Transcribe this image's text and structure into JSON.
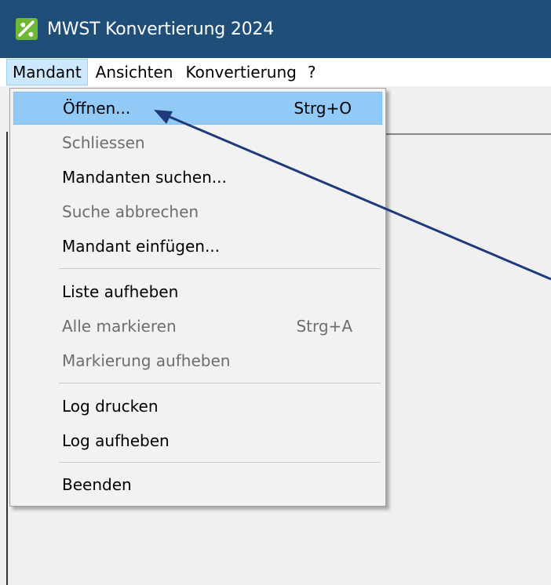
{
  "window": {
    "title": "MWST Konvertierung 2024",
    "icon": "app-logo-icon"
  },
  "menubar": {
    "items": [
      "Mandant",
      "Ansichten",
      "Konvertierung",
      "?"
    ]
  },
  "dropdown": {
    "items": [
      {
        "label": "Öffnen...",
        "shortcut": "Strg+O",
        "disabled": false,
        "highlighted": true
      },
      {
        "label": "Schliessen",
        "shortcut": "",
        "disabled": true
      },
      {
        "label": "Mandanten suchen...",
        "shortcut": "",
        "disabled": false
      },
      {
        "label": "Suche abbrechen",
        "shortcut": "",
        "disabled": true
      },
      {
        "label": "Mandant einfügen...",
        "shortcut": "",
        "disabled": false
      },
      {
        "label": "Liste aufheben",
        "shortcut": "",
        "disabled": false
      },
      {
        "label": "Alle markieren",
        "shortcut": "Strg+A",
        "disabled": true
      },
      {
        "label": "Markierung aufheben",
        "shortcut": "",
        "disabled": true
      },
      {
        "label": "Log drucken",
        "shortcut": "",
        "disabled": false
      },
      {
        "label": "Log aufheben",
        "shortcut": "",
        "disabled": false
      },
      {
        "label": "Beenden",
        "shortcut": "",
        "disabled": false
      }
    ]
  },
  "colors": {
    "titlebar": "#1f4e79",
    "highlight": "#91c9f7",
    "arrow": "#1f3a7a"
  }
}
